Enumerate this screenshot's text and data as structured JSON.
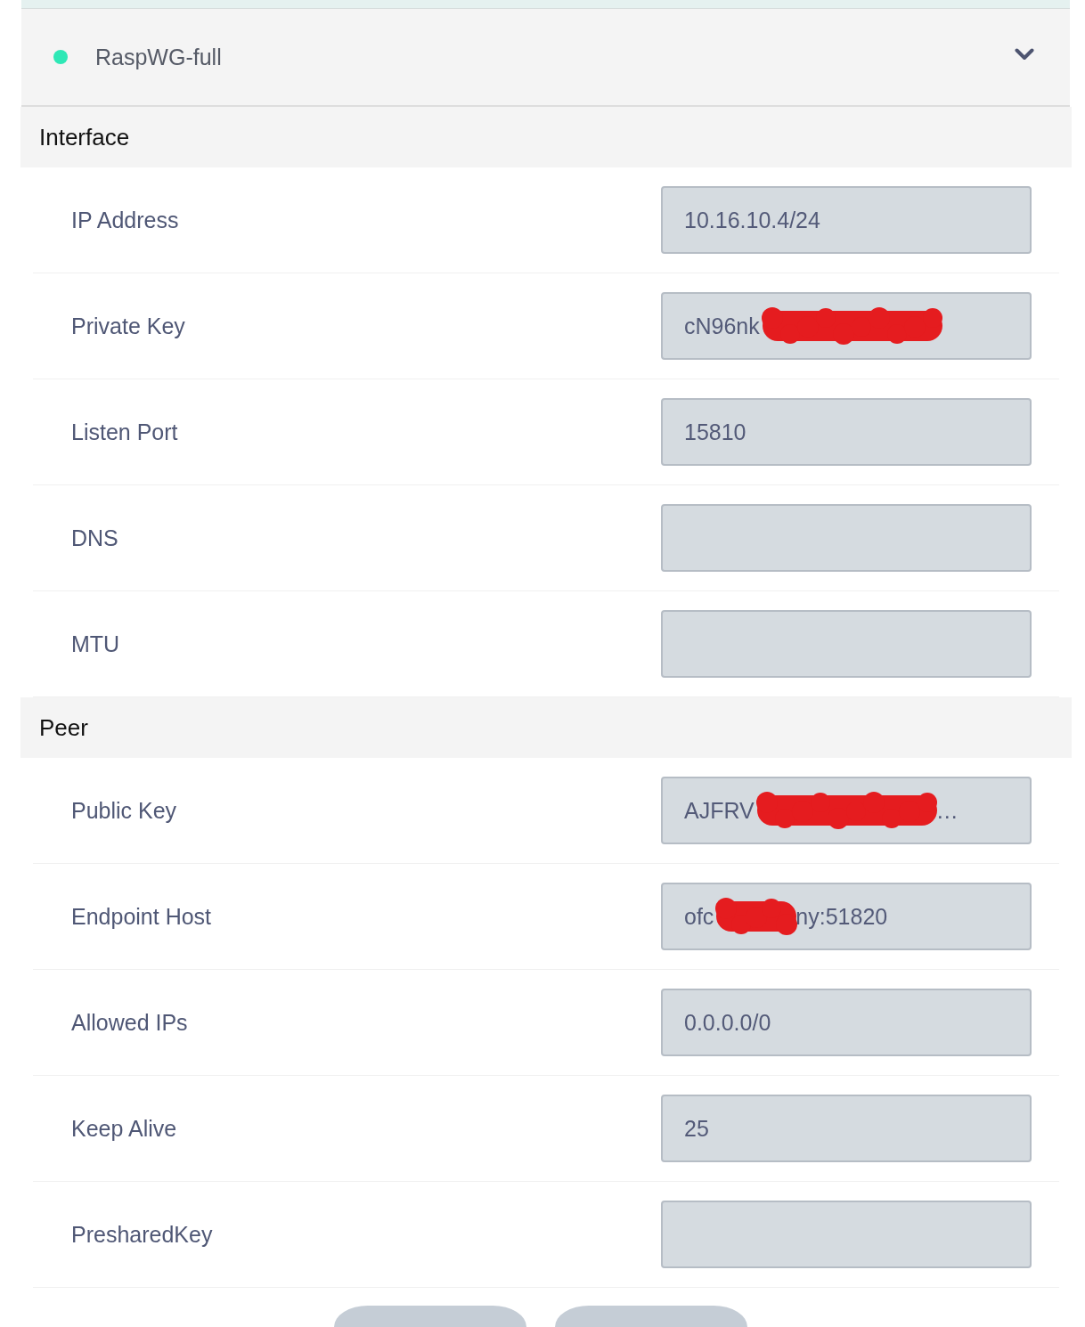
{
  "tunnel": {
    "name": "RaspWG-full",
    "active": true,
    "expanded": true
  },
  "sections": [
    {
      "title": "Interface",
      "fields": [
        {
          "label": "IP Address",
          "value": [
            {
              "kind": "text",
              "text": "10.16.10.4/24"
            }
          ]
        },
        {
          "label": "Private Key",
          "value": [
            {
              "kind": "text",
              "text": "cN96nk"
            },
            {
              "kind": "scribble"
            }
          ]
        },
        {
          "label": "Listen Port",
          "value": [
            {
              "kind": "text",
              "text": "15810"
            }
          ]
        },
        {
          "label": "DNS"
        },
        {
          "label": "MTU"
        }
      ]
    },
    {
      "title": "Peer",
      "fields": [
        {
          "label": "Public Key",
          "value": [
            {
              "kind": "text",
              "text": "AJFRV"
            },
            {
              "kind": "scribble"
            },
            {
              "kind": "text",
              "text": "…"
            }
          ]
        },
        {
          "label": "Endpoint Host",
          "value": [
            {
              "kind": "text",
              "text": "ofc"
            },
            {
              "kind": "blot"
            },
            {
              "kind": "text",
              "text": "ny:51820"
            }
          ]
        },
        {
          "label": "Allowed IPs",
          "value": [
            {
              "kind": "text",
              "text": "0.0.0.0/0"
            }
          ]
        },
        {
          "label": "Keep Alive",
          "value": [
            {
              "kind": "text",
              "text": "25"
            }
          ]
        },
        {
          "label": "PresharedKey"
        }
      ]
    }
  ],
  "footer_buttons": [
    {
      "kind": "pill"
    },
    {
      "kind": "pill"
    }
  ]
}
